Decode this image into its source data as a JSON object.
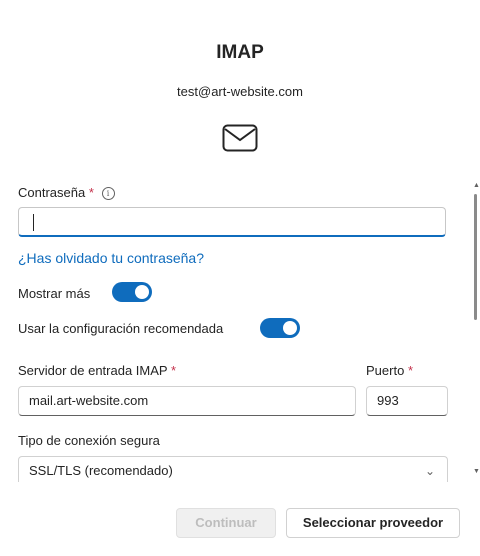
{
  "header": {
    "title": "IMAP",
    "email": "test@art-website.com",
    "icon": "mail-icon"
  },
  "form": {
    "password_label": "Contraseña",
    "required_marker": "*",
    "info_icon": "i",
    "password_value": "",
    "forgot_link": "¿Has olvidado tu contraseña?",
    "show_more_label": "Mostrar más",
    "show_more_on": true,
    "recommended_label": "Usar la configuración recomendada",
    "recommended_on": true,
    "incoming_server_label": "Servidor de entrada IMAP",
    "incoming_server_value": "mail.art-website.com",
    "port_label": "Puerto",
    "port_value": "993",
    "connection_label": "Tipo de conexión segura",
    "connection_value": "SSL/TLS (recomendado)"
  },
  "footer": {
    "continue_label": "Continuar",
    "select_provider_label": "Seleccionar proveedor"
  },
  "colors": {
    "accent": "#0f6cbd",
    "required": "#c4314b"
  }
}
